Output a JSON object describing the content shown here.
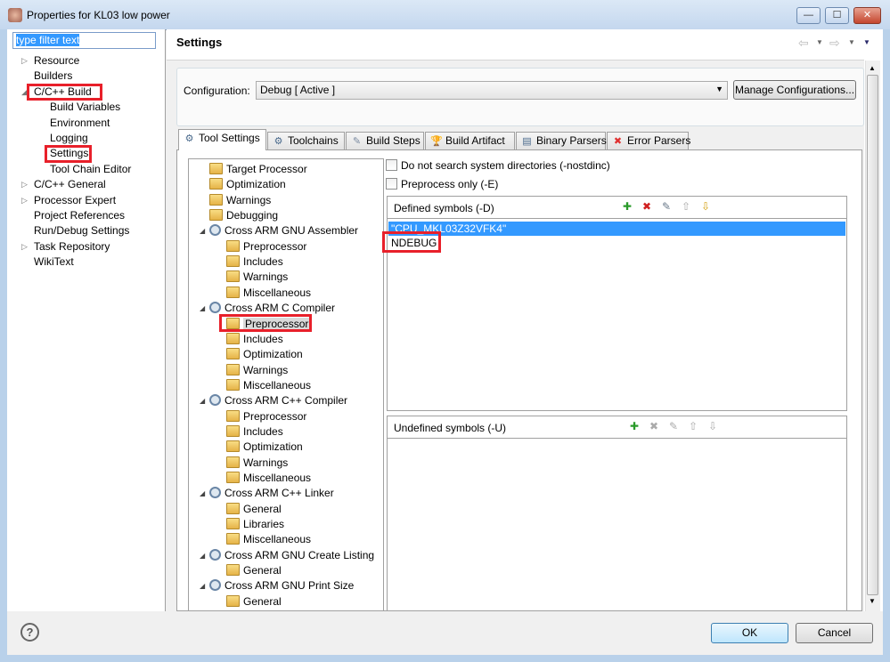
{
  "window": {
    "title": "Properties for KL03 low power",
    "minimize": "—",
    "maximize": "☐",
    "close": "✕"
  },
  "filter": {
    "placeholder": "type filter text"
  },
  "nav": [
    {
      "label": "Resource",
      "arrow": "▷"
    },
    {
      "label": "Builders"
    },
    {
      "label": "C/C++ Build",
      "arrow": "◢",
      "highlight": true
    },
    {
      "label": "Build Variables",
      "child": true
    },
    {
      "label": "Environment",
      "child": true
    },
    {
      "label": "Logging",
      "child": true
    },
    {
      "label": "Settings",
      "child": true,
      "selected": true,
      "highlight": true
    },
    {
      "label": "Tool Chain Editor",
      "child": true
    },
    {
      "label": "C/C++ General",
      "arrow": "▷"
    },
    {
      "label": "Processor Expert",
      "arrow": "▷"
    },
    {
      "label": "Project References"
    },
    {
      "label": "Run/Debug Settings"
    },
    {
      "label": "Task Repository",
      "arrow": "▷"
    },
    {
      "label": "WikiText"
    }
  ],
  "header": {
    "title": "Settings",
    "back": "⇦",
    "forward": "⇨",
    "menu": "▼"
  },
  "configuration": {
    "label": "Configuration:",
    "value": "Debug  [ Active ]",
    "manage": "Manage Configurations..."
  },
  "tabs": [
    {
      "label": "Tool Settings",
      "icon": "gear-icon",
      "active": true
    },
    {
      "label": "Toolchains",
      "icon": "gear-icon"
    },
    {
      "label": "Build Steps",
      "icon": "wand-icon"
    },
    {
      "label": "Build Artifact",
      "icon": "trophy-icon"
    },
    {
      "label": "Binary Parsers",
      "icon": "binary-icon"
    },
    {
      "label": "Error Parsers",
      "icon": "error-icon"
    }
  ],
  "tool_tree": [
    {
      "label": "Target Processor",
      "level": 0,
      "type": "folder"
    },
    {
      "label": "Optimization",
      "level": 0,
      "type": "folder"
    },
    {
      "label": "Warnings",
      "level": 0,
      "type": "folder"
    },
    {
      "label": "Debugging",
      "level": 0,
      "type": "folder"
    },
    {
      "label": "Cross ARM GNU Assembler",
      "level": 0,
      "type": "tool"
    },
    {
      "label": "Preprocessor",
      "level": 1,
      "type": "folder"
    },
    {
      "label": "Includes",
      "level": 1,
      "type": "folder"
    },
    {
      "label": "Warnings",
      "level": 1,
      "type": "folder"
    },
    {
      "label": "Miscellaneous",
      "level": 1,
      "type": "folder"
    },
    {
      "label": "Cross ARM C Compiler",
      "level": 0,
      "type": "tool"
    },
    {
      "label": "Preprocessor",
      "level": 1,
      "type": "folder",
      "selected": true,
      "highlight": true
    },
    {
      "label": "Includes",
      "level": 1,
      "type": "folder"
    },
    {
      "label": "Optimization",
      "level": 1,
      "type": "folder"
    },
    {
      "label": "Warnings",
      "level": 1,
      "type": "folder"
    },
    {
      "label": "Miscellaneous",
      "level": 1,
      "type": "folder"
    },
    {
      "label": "Cross ARM C++ Compiler",
      "level": 0,
      "type": "tool"
    },
    {
      "label": "Preprocessor",
      "level": 1,
      "type": "folder"
    },
    {
      "label": "Includes",
      "level": 1,
      "type": "folder"
    },
    {
      "label": "Optimization",
      "level": 1,
      "type": "folder"
    },
    {
      "label": "Warnings",
      "level": 1,
      "type": "folder"
    },
    {
      "label": "Miscellaneous",
      "level": 1,
      "type": "folder"
    },
    {
      "label": "Cross ARM C++ Linker",
      "level": 0,
      "type": "tool"
    },
    {
      "label": "General",
      "level": 1,
      "type": "folder"
    },
    {
      "label": "Libraries",
      "level": 1,
      "type": "folder"
    },
    {
      "label": "Miscellaneous",
      "level": 1,
      "type": "folder"
    },
    {
      "label": "Cross ARM GNU Create Listing",
      "level": 0,
      "type": "tool"
    },
    {
      "label": "General",
      "level": 1,
      "type": "folder"
    },
    {
      "label": "Cross ARM GNU Print Size",
      "level": 0,
      "type": "tool"
    },
    {
      "label": "General",
      "level": 1,
      "type": "folder"
    }
  ],
  "options": {
    "nostdinc": {
      "label": "Do not search system directories (-nostdinc)",
      "checked": false
    },
    "preprocess_only": {
      "label": "Preprocess only (-E)",
      "checked": false
    }
  },
  "defined": {
    "title": "Defined symbols (-D)",
    "items": [
      "\"CPU_MKL03Z32VFK4\"",
      "NDEBUG"
    ]
  },
  "undefined": {
    "title": "Undefined symbols (-U)",
    "items": []
  },
  "list_tools": [
    "add-icon",
    "delete-icon",
    "edit-icon",
    "move-up-icon",
    "move-down-icon"
  ],
  "footer": {
    "help": "?",
    "ok": "OK",
    "cancel": "Cancel"
  },
  "colors": {
    "selection": "#3399ff",
    "highlight": "#e8202a"
  }
}
